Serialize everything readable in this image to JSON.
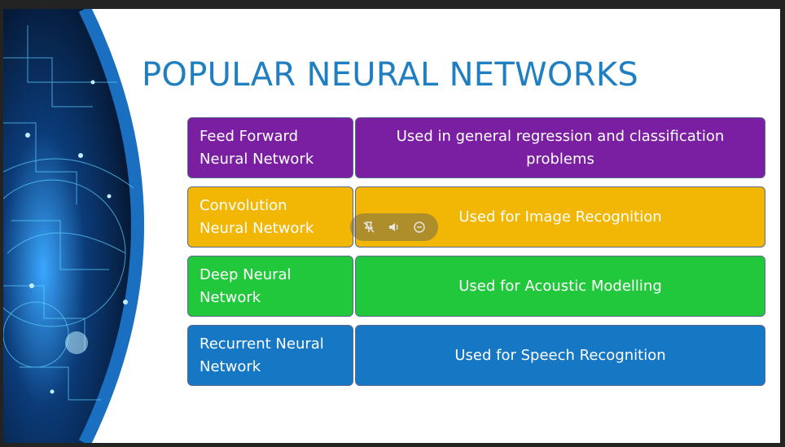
{
  "slide": {
    "title": "POPULAR NEURAL NETWORKS",
    "rows": [
      {
        "name_lines": [
          "Feed Forward",
          "Neural Network"
        ],
        "desc_lines": [
          "Used in general regression and classification",
          "problems"
        ],
        "color": "#7a1fa2"
      },
      {
        "name_lines": [
          "Convolution",
          "Neural Network"
        ],
        "desc_lines": [
          "Used for Image Recognition"
        ],
        "color": "#f2b705"
      },
      {
        "name_lines": [
          "Deep Neural",
          "Network"
        ],
        "desc_lines": [
          "Used for Acoustic Modelling"
        ],
        "color": "#22c83c"
      },
      {
        "name_lines": [
          "Recurrent Neural",
          "Network"
        ],
        "desc_lines": [
          "Used for Speech Recognition"
        ],
        "color": "#1677c4"
      }
    ]
  },
  "colors": {
    "title": "#1f7fc0",
    "arc": "#1a6fc0"
  },
  "media_controls": {
    "icons": [
      "pin-off-icon",
      "volume-icon",
      "minus-circle-icon"
    ]
  }
}
